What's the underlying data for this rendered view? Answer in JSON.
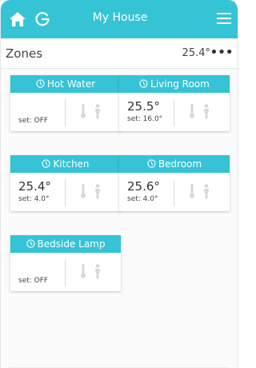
{
  "header": {
    "title": "My House",
    "home_icon": "home-icon",
    "power_icon": "power-icon",
    "menu_icon": "menu-icon",
    "accent_color": "#35c4d6"
  },
  "zones_bar": {
    "label": "Zones",
    "temperature": "25.4°",
    "more": "•••"
  },
  "zones": [
    {
      "name": "Hot Water",
      "reading": "",
      "setpoint": "set: OFF"
    },
    {
      "name": "Living Room",
      "reading": "25.5°",
      "setpoint": "set: 16.0°"
    },
    {
      "name": "Kitchen",
      "reading": "25.4°",
      "setpoint": "set: 4.0°"
    },
    {
      "name": "Bedroom",
      "reading": "25.6°",
      "setpoint": "set: 4.0°"
    },
    {
      "name": "Bedside Lamp",
      "reading": "",
      "setpoint": "set: OFF"
    }
  ]
}
